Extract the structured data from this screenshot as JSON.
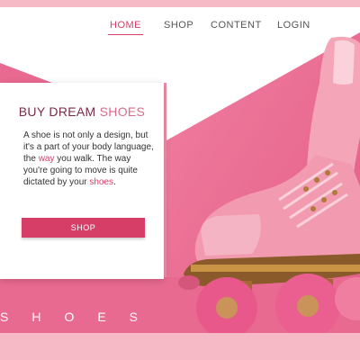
{
  "nav": {
    "items": [
      {
        "label": "HOME",
        "active": true
      },
      {
        "label": "SHOP",
        "active": false
      },
      {
        "label": "CONTENT",
        "active": false
      },
      {
        "label": "LOGIN",
        "active": false
      }
    ]
  },
  "hero": {
    "title_main": "BUY DREAM ",
    "title_accent": "SHOES",
    "body": {
      "part1": "A shoe is not only a design, but it's a part of your body language, the ",
      "highlight1": "way",
      "part2": " you walk. The way you're going to move is quite dictated by your ",
      "highlight2": "shoes",
      "part3": "."
    },
    "button_label": "SHOP",
    "footer_word": "SHOES"
  },
  "colors": {
    "accent": "#d63e68",
    "pink_bg": "#f6b9c6",
    "hero_pink": "#e96a90"
  },
  "image": {
    "icon": "roller-skate-image"
  }
}
